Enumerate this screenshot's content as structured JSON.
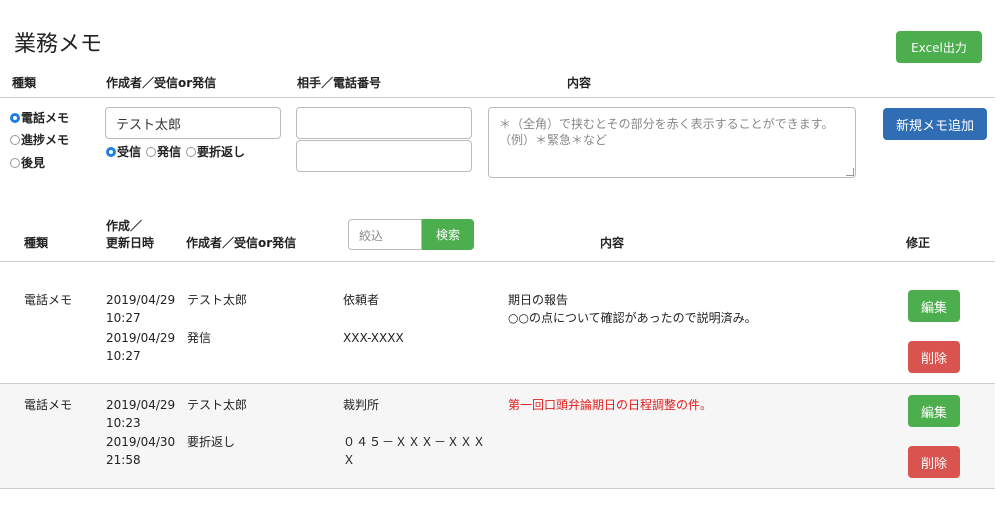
{
  "page": {
    "title": "業務メモ",
    "excel_button": "Excel出力"
  },
  "form": {
    "headers": {
      "type": "種類",
      "author": "作成者／受信or発信",
      "partner": "相手／電話番号",
      "content": "内容"
    },
    "type_options": [
      {
        "label": "電話メモ",
        "selected": true
      },
      {
        "label": "進捗メモ",
        "selected": false
      },
      {
        "label": "後見",
        "selected": false
      }
    ],
    "author_value": "テスト太郎",
    "direction_options": [
      {
        "label": "受信",
        "selected": true
      },
      {
        "label": "発信",
        "selected": false
      },
      {
        "label": "要折返し",
        "selected": false
      }
    ],
    "partner_value": "",
    "phone_value": "",
    "content_placeholder": "＊（全角）で挟むとその部分を赤く表示することができます。\n（例）＊緊急＊など",
    "add_button": "新規メモ追加"
  },
  "list": {
    "headers": {
      "type": "種類",
      "datetime_line1": "作成／",
      "datetime_line2": "更新日時",
      "author": "作成者／受信or発信",
      "filter_placeholder": "絞込",
      "search_button": "検索",
      "content": "内容",
      "edit": "修正"
    },
    "rows": [
      {
        "type": "電話メモ",
        "created_date": "2019/04/29",
        "created_time": "10:27",
        "author": "テスト太郎",
        "updated_date": "2019/04/29",
        "updated_time": "10:27",
        "direction": "発信",
        "partner": "依頼者",
        "phone": "XXX-XXXX",
        "content_line1": "期日の報告",
        "content_line2": "○○の点について確認があったので説明済み。",
        "highlight": false,
        "edit_button": "編集",
        "delete_button": "削除"
      },
      {
        "type": "電話メモ",
        "created_date": "2019/04/29",
        "created_time": "10:23",
        "author": "テスト太郎",
        "updated_date": "2019/04/30",
        "updated_time": "21:58",
        "direction": "要折返し",
        "partner": "裁判所",
        "phone_line1": "０４５－ＸＸＸ－ＸＸＸ",
        "phone_line2": "Ｘ",
        "content_line1": "第一回口頭弁論期日の日程調整の件。",
        "content_line2": "",
        "highlight": true,
        "edit_button": "編集",
        "delete_button": "削除"
      }
    ]
  },
  "colors": {
    "green": "#4cae4c",
    "blue": "#2f6db5",
    "red_button": "#d9534f",
    "highlight_text": "#e31b1b",
    "radio_selected": "#1e7fe0"
  }
}
